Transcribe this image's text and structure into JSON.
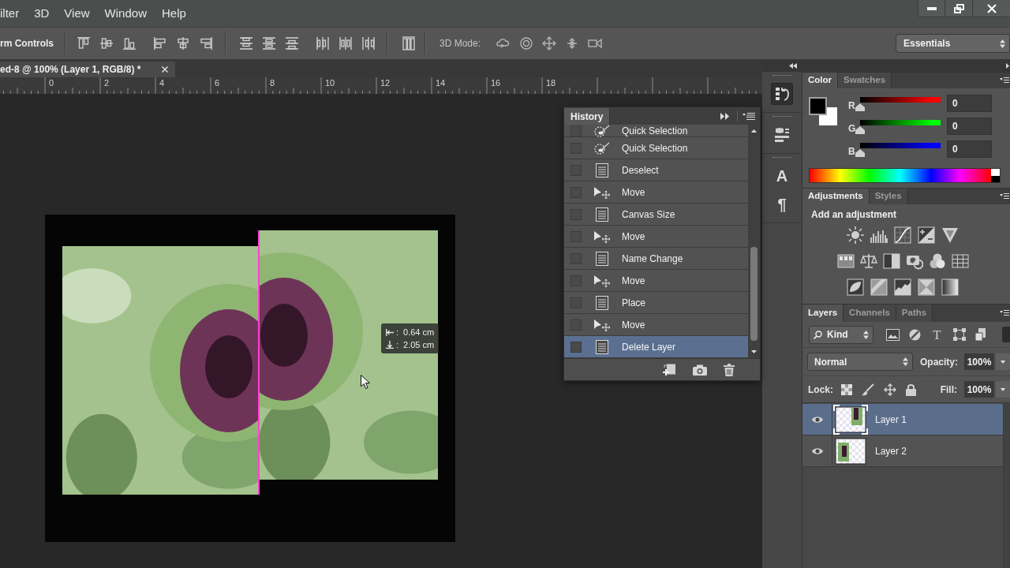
{
  "menu_bar": {
    "items": [
      "ilter",
      "3D",
      "View",
      "Window",
      "Help"
    ]
  },
  "options_bar": {
    "tool_label": "rm Controls",
    "mode_label": "3D Mode:",
    "workspace": "Essentials"
  },
  "document": {
    "tab_title": "ed-8 @ 100% (Layer 1, RGB/8) *",
    "ruler_labels": [
      "0",
      "2",
      "4",
      "6",
      "8",
      "10",
      "12",
      "14",
      "16",
      "18"
    ],
    "measure_tip": [
      {
        "kind": "horizontal",
        "sep": ":",
        "value": "0.64 cm"
      },
      {
        "kind": "vertical",
        "sep": ":",
        "value": "2.05 cm"
      }
    ]
  },
  "history": {
    "tabs": [
      {
        "label": "History",
        "selected": true
      }
    ],
    "items": [
      {
        "label": "Quick Selection",
        "kind": "brush",
        "selected": false
      },
      {
        "label": "Quick Selection",
        "kind": "brush",
        "selected": false
      },
      {
        "label": "Deselect",
        "kind": "document",
        "selected": false
      },
      {
        "label": "Move",
        "kind": "move",
        "selected": false
      },
      {
        "label": "Canvas Size",
        "kind": "document",
        "selected": false
      },
      {
        "label": "Move",
        "kind": "move",
        "selected": false
      },
      {
        "label": "Name Change",
        "kind": "document",
        "selected": false
      },
      {
        "label": "Move",
        "kind": "move",
        "selected": false
      },
      {
        "label": "Place",
        "kind": "document",
        "selected": false
      },
      {
        "label": "Move",
        "kind": "move",
        "selected": false
      },
      {
        "label": "Delete Layer",
        "kind": "document",
        "selected": true
      }
    ]
  },
  "dock": {
    "groups": [
      {
        "items": [
          {
            "kind": "history",
            "selected": true
          }
        ]
      },
      {
        "items": [
          {
            "kind": "properties",
            "selected": false
          }
        ]
      },
      {
        "items": [
          {
            "kind": "glyph",
            "glyph": "A",
            "selected": false
          },
          {
            "kind": "glyph",
            "glyph": "¶",
            "selected": false
          }
        ]
      }
    ]
  },
  "color": {
    "tabs": [
      {
        "label": "Color",
        "selected": true
      },
      {
        "label": "Swatches",
        "selected": false
      }
    ],
    "swatches": [
      {
        "kind": "foreground",
        "color": "#000000"
      },
      {
        "kind": "background",
        "color": "#ffffff"
      }
    ],
    "channels": [
      {
        "label": "R",
        "color": "#ff0000",
        "level": 0,
        "value": "0"
      },
      {
        "label": "G",
        "color": "#00ff00",
        "level": 0,
        "value": "0"
      },
      {
        "label": "B",
        "color": "#0000ff",
        "level": 0,
        "value": "0"
      }
    ]
  },
  "adjustments": {
    "tabs": [
      {
        "label": "Adjustments",
        "selected": true
      },
      {
        "label": "Styles",
        "selected": false
      }
    ],
    "heading": "Add an adjustment"
  },
  "layers": {
    "tabs": [
      {
        "label": "Layers",
        "selected": true
      },
      {
        "label": "Channels",
        "selected": false
      },
      {
        "label": "Paths",
        "selected": false
      }
    ],
    "filter": "Kind",
    "type_glyph": "T",
    "blend_mode": "Normal",
    "opacity_label": "Opacity:",
    "opacity": "100%",
    "lock_label": "Lock:",
    "fill_label": "Fill:",
    "fill": "100%",
    "items": [
      {
        "name": "Layer 1",
        "visible": true,
        "selected": true
      },
      {
        "name": "Layer 2",
        "visible": true,
        "selected": false
      }
    ]
  }
}
